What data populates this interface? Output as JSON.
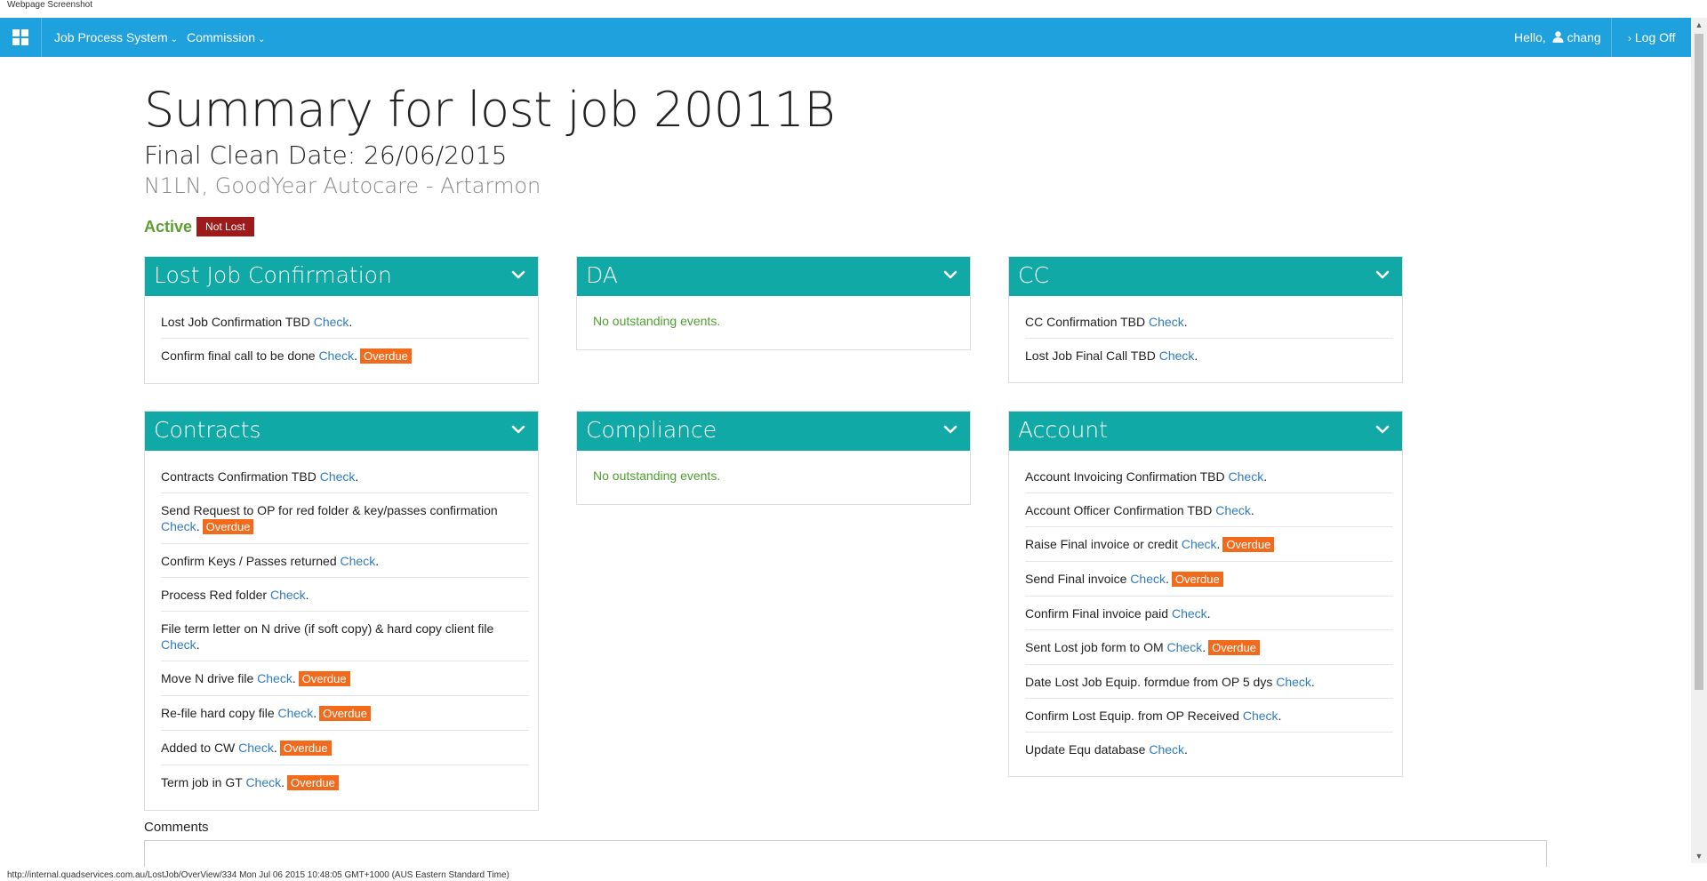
{
  "caption": "Webpage Screenshot",
  "nav": {
    "menu1": "Job Process System",
    "menu2": "Commission",
    "hello": "Hello,",
    "user": "chang",
    "logoff": "Log Off",
    "color": "#1ea1dc"
  },
  "header": {
    "title": "Summary for lost job 20011B",
    "final_clean": "Final Clean Date: 26/06/2015",
    "site": "N1LN, GoodYear Autocare - Artarmon",
    "status": "Active",
    "badge": "Not Lost"
  },
  "panels": [
    {
      "title": "Lost Job Confirmation",
      "items": [
        {
          "text": "Lost Job Confirmation TBD",
          "link": "Check",
          "overdue": ""
        },
        {
          "text": "Confirm final call to be done",
          "link": "Check",
          "overdue": "Overdue"
        }
      ]
    },
    {
      "title": "DA",
      "empty": "No outstanding events."
    },
    {
      "title": "CC",
      "items": [
        {
          "text": "CC Confirmation TBD",
          "link": "Check",
          "overdue": ""
        },
        {
          "text": "Lost Job Final Call TBD",
          "link": "Check",
          "overdue": ""
        }
      ]
    },
    {
      "title": "Contracts",
      "items": [
        {
          "text": "Contracts Confirmation TBD",
          "link": "Check",
          "overdue": ""
        },
        {
          "text": "Send Request to OP for red folder & key/passes confirmation",
          "link": "Check",
          "overdue": "Overdue"
        },
        {
          "text": "Confirm Keys / Passes returned",
          "link": "Check",
          "overdue": ""
        },
        {
          "text": "Process Red folder",
          "link": "Check",
          "overdue": ""
        },
        {
          "text": "File term letter on N drive (if soft copy) & hard copy client file",
          "link": "Check",
          "overdue": ""
        },
        {
          "text": "Move N drive file",
          "link": "Check",
          "overdue": "Overdue"
        },
        {
          "text": "Re-file hard copy file",
          "link": "Check",
          "overdue": "Overdue"
        },
        {
          "text": "Added to CW",
          "link": "Check",
          "overdue": "Overdue"
        },
        {
          "text": "Term job in GT",
          "link": "Check",
          "overdue": "Overdue"
        }
      ]
    },
    {
      "title": "Compliance",
      "empty": "No outstanding events."
    },
    {
      "title": "Account",
      "items": [
        {
          "text": "Account Invoicing Confirmation TBD",
          "link": "Check",
          "overdue": ""
        },
        {
          "text": "Account Officer Confirmation TBD",
          "link": "Check",
          "overdue": ""
        },
        {
          "text": "Raise Final invoice or credit",
          "link": "Check",
          "overdue": "Overdue"
        },
        {
          "text": "Send Final invoice",
          "link": "Check",
          "overdue": "Overdue"
        },
        {
          "text": "Confirm Final invoice paid",
          "link": "Check",
          "overdue": ""
        },
        {
          "text": "Sent Lost job form to OM",
          "link": "Check",
          "overdue": "Overdue"
        },
        {
          "text": "Date Lost Job Equip. formdue from OP 5 dys",
          "link": "Check",
          "overdue": ""
        },
        {
          "text": "Confirm Lost Equip. from OP Received",
          "link": "Check",
          "overdue": ""
        },
        {
          "text": "Update Equ database",
          "link": "Check",
          "overdue": ""
        }
      ]
    }
  ],
  "comments_label": "Comments",
  "statusbar": "http://internal.quadservices.com.au/LostJob/OverView/334 Mon Jul 06 2015 10:48:05 GMT+1000 (AUS Eastern Standard Time)",
  "colors": {
    "panel_header": "#10a9a6",
    "overdue": "#f26b1d",
    "not_lost": "#9e1b1b",
    "active": "#5c9e2f",
    "link": "#2f7cc1"
  }
}
